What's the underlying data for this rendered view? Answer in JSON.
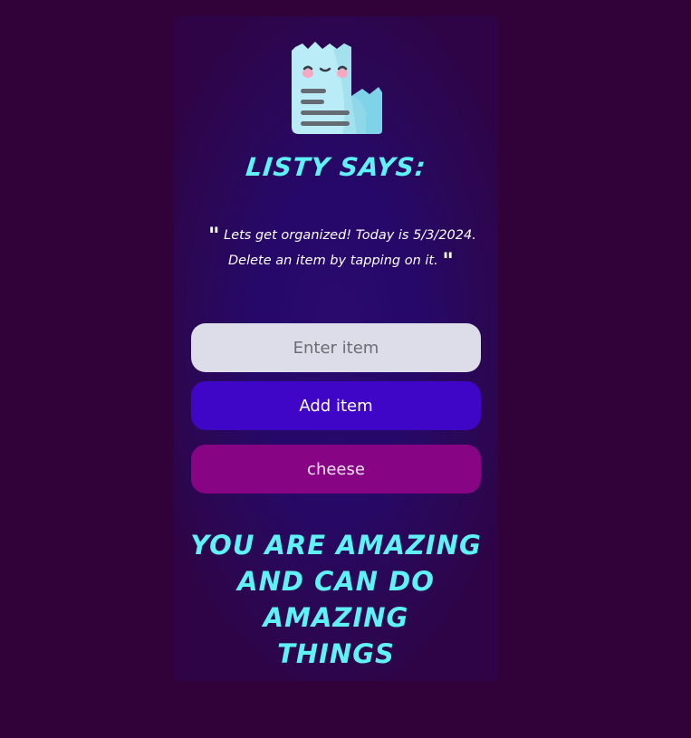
{
  "header": {
    "logo_icon": "receipt-mascot-icon",
    "title": "LISTY SAYS:"
  },
  "message": {
    "line1": "Lets get organized! Today is 5/3/2024.",
    "line2": "Delete an item by tapping on it.",
    "open_quote": "\"",
    "close_quote": "\""
  },
  "form": {
    "input_placeholder": "Enter item",
    "input_value": "",
    "add_label": "Add item"
  },
  "items": [
    {
      "label": "cheese"
    }
  ],
  "footer": {
    "line1": "YOU ARE AMAZING",
    "line2": "AND CAN DO AMAZING",
    "line3": "THINGS"
  },
  "colors": {
    "background": "#310239",
    "heading": "#5ef2f4",
    "add_button": "#4006c8",
    "item_button": "#870585",
    "input_bg": "#dcdde8"
  }
}
